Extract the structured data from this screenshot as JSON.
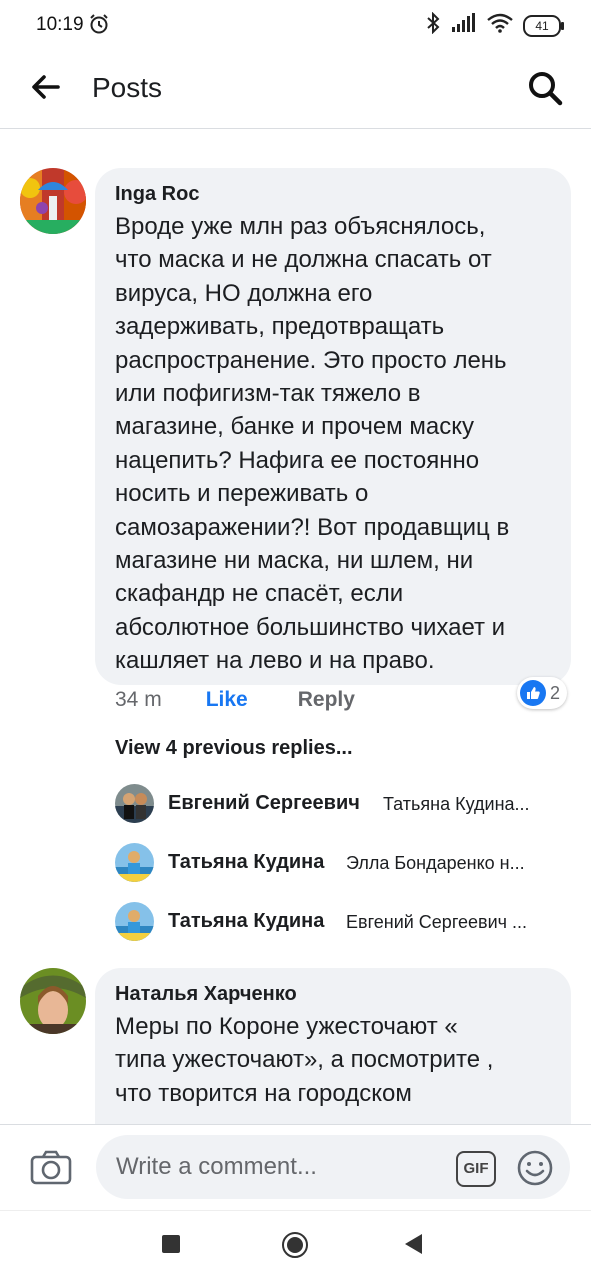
{
  "status_bar": {
    "time": "10:19",
    "battery": "41"
  },
  "header": {
    "title": "Posts"
  },
  "comment1": {
    "author": "Inga Roc",
    "text": "Вроде уже млн раз объяснялось,\nчто маска и не должна спасать от\nвируса, НО должна его\nзадерживать, предотвращать\nраспространение. Это просто лень\nили пофигизм-так тяжело в\nмагазине, банке и прочем маску\nнацепить? Нафига ее постоянно\nносить и переживать о\nсамозаражении?! Вот продавщиц в\nмагазине ни маска, ни шлем, ни\nскафандр не спасёт, если\nабсолютное большинство чихает и\nкашляет на лево и на право.",
    "timestamp": "34 m",
    "like_label": "Like",
    "reply_label": "Reply",
    "reaction_count": "2",
    "view_previous": "View 4 previous replies...",
    "replies": [
      {
        "name": "Евгений Сергеевич",
        "preview": "Татьяна Кудина..."
      },
      {
        "name": "Татьяна Кудина",
        "preview": "Элла Бондаренко н..."
      },
      {
        "name": "Татьяна Кудина",
        "preview": "Евгений Сергеевич ..."
      }
    ]
  },
  "comment2": {
    "author": "Наталья Харченко",
    "text": "Меры по Короне ужесточают «\nтипа ужесточают», а посмотрите ,\nчто творится на городском"
  },
  "composer": {
    "placeholder": "Write a comment...",
    "gif_label": "GIF"
  },
  "colors": {
    "accent": "#1877f2",
    "bubble": "#f0f2f5",
    "secondary_text": "#65676b"
  }
}
